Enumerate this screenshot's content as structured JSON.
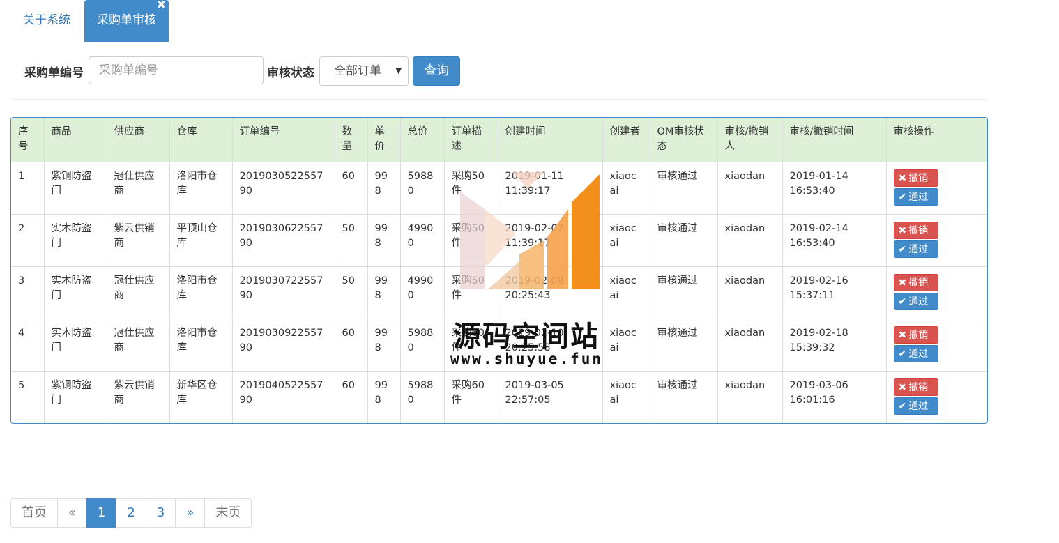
{
  "tabs": [
    {
      "label": "关于系统",
      "active": false
    },
    {
      "label": "采购单审核",
      "active": true
    }
  ],
  "search": {
    "order_no_label": "采购单编号",
    "order_no_placeholder": "采购单编号",
    "status_label": "审核状态",
    "status_value": "全部订单",
    "query_button": "查询"
  },
  "table": {
    "headers": [
      "序号",
      "商品",
      "供应商",
      "仓库",
      "订单编号",
      "数量",
      "单价",
      "总价",
      "订单描述",
      "创建时间",
      "创建者",
      "OM审核状态",
      "审核/撤销人",
      "审核/撤销时间",
      "审核操作"
    ],
    "rows": [
      [
        "1",
        "紫铜防盗门",
        "冠仕供应商",
        "洛阳市仓库",
        "201903052255790",
        "60",
        "998",
        "59880",
        "采购50件",
        "2019-01-11 11:39:17",
        "xiaocai",
        "审核通过",
        "xiaodan",
        "2019-01-14 16:53:40"
      ],
      [
        "2",
        "实木防盗门",
        "紫云供销商",
        "平顶山仓库",
        "201903062255790",
        "50",
        "998",
        "49900",
        "采购50件",
        "2019-02-07 11:39:17",
        "xiaocai",
        "审核通过",
        "xiaodan",
        "2019-02-14 16:53:40"
      ],
      [
        "3",
        "实木防盗门",
        "冠仕供应商",
        "洛阳市仓库",
        "201903072255790",
        "50",
        "998",
        "49900",
        "采购50件",
        "2019-02-09 20:25:43",
        "xiaocai",
        "审核通过",
        "xiaodan",
        "2019-02-16 15:37:11"
      ],
      [
        "4",
        "实木防盗门",
        "冠仕供应商",
        "洛阳市仓库",
        "201903092255790",
        "60",
        "998",
        "59880",
        "采购60件",
        "2019-02-10 20:25:58",
        "xiaocai",
        "审核通过",
        "xiaodan",
        "2019-02-18 15:39:32"
      ],
      [
        "5",
        "紫铜防盗门",
        "紫云供销商",
        "新华区仓库",
        "201904052255790",
        "60",
        "998",
        "59880",
        "采购60件",
        "2019-03-05 22:57:05",
        "xiaocai",
        "审核通过",
        "xiaodan",
        "2019-03-06 16:01:16"
      ]
    ],
    "revoke_label": "撤销",
    "pass_label": "通过"
  },
  "pagination": {
    "first": "首页",
    "prev": "«",
    "pages": [
      "1",
      "2",
      "3"
    ],
    "next": "»",
    "last": "末页",
    "current": "1"
  },
  "watermark": {
    "title": "源码空间站",
    "url": "www.shuyue.fun"
  },
  "colors": {
    "primary": "#428bca",
    "danger": "#d9534f",
    "header_bg": "#dff0d8"
  }
}
